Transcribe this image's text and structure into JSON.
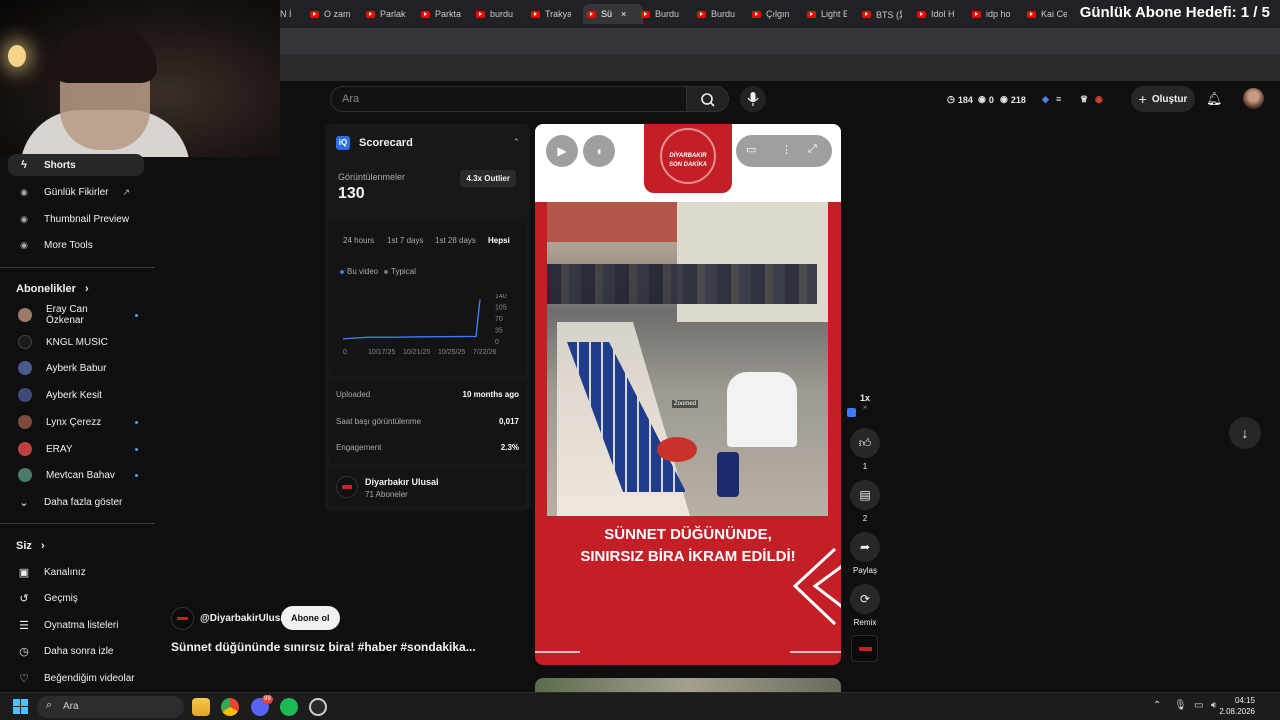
{
  "browser": {
    "tabs": [
      {
        "label": "N İ",
        "active": false
      },
      {
        "label": "O zam",
        "active": false
      },
      {
        "label": "Parlak",
        "active": false
      },
      {
        "label": "Parkta",
        "active": false
      },
      {
        "label": "burdu",
        "active": false
      },
      {
        "label": "Trakya",
        "active": false
      },
      {
        "label": "Sü",
        "active": true
      },
      {
        "label": "Burdu",
        "active": false
      },
      {
        "label": "Burdu",
        "active": false
      },
      {
        "label": "Çılgın",
        "active": false
      },
      {
        "label": "Light E",
        "active": false
      },
      {
        "label": "BTS (异",
        "active": false
      },
      {
        "label": "Idol H",
        "active": false
      },
      {
        "label": "idp ho",
        "active": false
      },
      {
        "label": "Kai Ce",
        "active": false
      }
    ],
    "overlay_goal": "Günlük Abone Hedefi: 1 / 5"
  },
  "sidebar": {
    "top_items": [
      {
        "label": "Shorts",
        "icon": "shorts-icon"
      },
      {
        "label": "Günlük Fikirler",
        "icon": "lightbulb-icon",
        "external": "↗"
      },
      {
        "label": "Thumbnail Preview",
        "icon": "image-icon"
      },
      {
        "label": "More Tools",
        "icon": "tools-icon"
      }
    ],
    "subscriptions_title": "Abonelikler",
    "subscriptions": [
      {
        "label": "Eray Can Özkenar",
        "color": "#9a7b6a",
        "new": true
      },
      {
        "label": "KNGL MUSIC",
        "color": "#1b1b1b",
        "new": false
      },
      {
        "label": "Ayberk Babur",
        "color": "#4a5a8a",
        "new": false
      },
      {
        "label": "Ayberk Kesit",
        "color": "#3d4a7a",
        "new": false
      },
      {
        "label": "Lynx Çerezz",
        "color": "#7a4a3a",
        "new": true
      },
      {
        "label": "ERAY",
        "color": "#c04040",
        "new": true
      },
      {
        "label": "Mevtcan Bahav",
        "color": "#4a7a6a",
        "new": true
      }
    ],
    "show_more": "Daha fazla göster",
    "you_title": "Siz",
    "you_items": [
      {
        "label": "Kanalınız",
        "icon": "channel-icon"
      },
      {
        "label": "Geçmiş",
        "icon": "history-icon"
      },
      {
        "label": "Oynatma listeleri",
        "icon": "playlist-icon"
      },
      {
        "label": "Daha sonra izle",
        "icon": "clock-icon"
      },
      {
        "label": "Beğendiğim videolar",
        "icon": "like-icon"
      }
    ]
  },
  "masthead": {
    "search_placeholder": "Ara",
    "stats": [
      {
        "icon": "clock-icon",
        "value": "184"
      },
      {
        "icon": "eye-icon",
        "value": "0"
      },
      {
        "icon": "eye-icon",
        "value": "218"
      }
    ],
    "create_label": "Oluştur"
  },
  "scorecard": {
    "title": "Scorecard",
    "logo": "iQ",
    "views_label": "Görüntülenmeler",
    "views_value": "130",
    "outlier": "4.3x Outlier",
    "tabs": [
      "24 hours",
      "1st 7 days",
      "1st 28 days",
      "Hepsi"
    ],
    "active_tab": 3,
    "legend": [
      {
        "label": "Bu video",
        "color": "#3e7bfa"
      },
      {
        "label": "Typical",
        "color": "#777777"
      }
    ],
    "y_ticks": [
      "140",
      "105",
      "70",
      "35",
      "0"
    ],
    "x_ticks": [
      "0",
      "10/17/25",
      "10/21/25",
      "10/25/25",
      "7/22/26"
    ],
    "rows": [
      {
        "label": "Uploaded",
        "value": "10 months ago"
      },
      {
        "label": "Saat başı görüntülenme",
        "value": "0,017"
      },
      {
        "label": "Engagement",
        "value": "2.3%"
      }
    ],
    "channel_name": "Diyarbakır Ulusal",
    "channel_subs": "71 Aboneler"
  },
  "chart_data": {
    "type": "line",
    "x": [
      "0",
      "10/17/25",
      "10/21/25",
      "10/25/25",
      "7/22/26"
    ],
    "series": [
      {
        "name": "Bu video",
        "values": [
          15,
          20,
          20,
          21,
          22,
          130
        ]
      }
    ],
    "ylim": [
      0,
      140
    ],
    "grid": false,
    "legend": "top-left"
  },
  "player": {
    "logo_line1": "DİYARBAKIR",
    "logo_line2": "SON DAKİKA",
    "headline_line1": "SÜNNET DÜĞÜNÜNDE,",
    "headline_line2": "SINIRSIZ BİRA İKRAM EDİLDİ!",
    "zoom_tag": "Zoomed",
    "speed": "1x",
    "like_count": "1",
    "comment_count": "2",
    "share_label": "Paylaş",
    "remix_label": "Remix"
  },
  "overlay": {
    "channel_handle": "@DiyarbakirUlusal",
    "subscribe_label": "Abone ol",
    "title": "Sünnet düğününde sınırsız bira! #haber #sondakika..."
  },
  "taskbar": {
    "search_placeholder": "Ara",
    "discord_badge": "99",
    "time": "04:15",
    "date": "2.08.2026"
  }
}
